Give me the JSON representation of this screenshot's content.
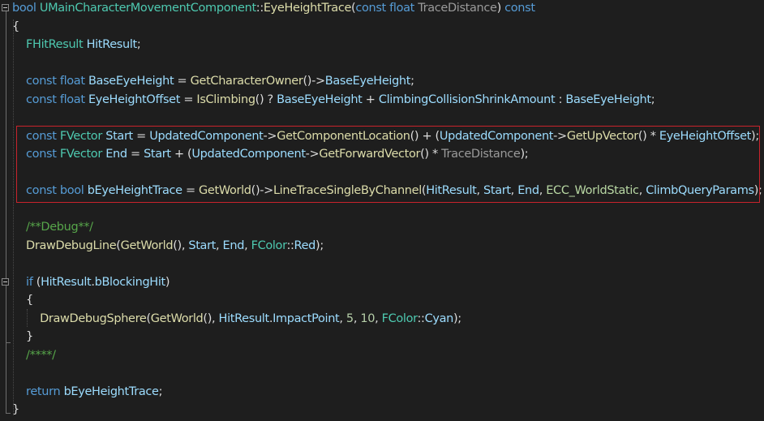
{
  "editor": {
    "language": "C++",
    "colors": {
      "background": "#1e1e1e",
      "keyword": "#569cd6",
      "type": "#4ec9b0",
      "function": "#dcdcaa",
      "variable": "#9cdcfe",
      "parameter": "#9a9a9a",
      "number": "#b5cea8",
      "comment": "#57a64a",
      "enum": "#b8d7a3",
      "text": "#dcdcdc",
      "highlight_border": "#c8232c"
    },
    "lines": [
      {
        "tokens": [
          {
            "c": "kw",
            "t": "bool"
          },
          {
            "c": "pl",
            "t": " "
          },
          {
            "c": "type",
            "t": "UMainCharacterMovementComponent"
          },
          {
            "c": "pl",
            "t": "::"
          },
          {
            "c": "fn",
            "t": "EyeHeightTrace"
          },
          {
            "c": "pl",
            "t": "("
          },
          {
            "c": "kw",
            "t": "const"
          },
          {
            "c": "pl",
            "t": " "
          },
          {
            "c": "kw",
            "t": "float"
          },
          {
            "c": "pl",
            "t": " "
          },
          {
            "c": "param",
            "t": "TraceDistance"
          },
          {
            "c": "pl",
            "t": ") "
          },
          {
            "c": "kw",
            "t": "const"
          }
        ]
      },
      {
        "tokens": [
          {
            "c": "pl",
            "t": "{"
          }
        ]
      },
      {
        "tokens": [
          {
            "c": "pl",
            "t": "    "
          },
          {
            "c": "type",
            "t": "FHitResult"
          },
          {
            "c": "pl",
            "t": " "
          },
          {
            "c": "var",
            "t": "HitResult"
          },
          {
            "c": "pl",
            "t": ";"
          }
        ]
      },
      {
        "tokens": []
      },
      {
        "tokens": [
          {
            "c": "pl",
            "t": "    "
          },
          {
            "c": "kw",
            "t": "const"
          },
          {
            "c": "pl",
            "t": " "
          },
          {
            "c": "kw",
            "t": "float"
          },
          {
            "c": "pl",
            "t": " "
          },
          {
            "c": "var",
            "t": "BaseEyeHeight"
          },
          {
            "c": "pl",
            "t": " = "
          },
          {
            "c": "fn",
            "t": "GetCharacterOwner"
          },
          {
            "c": "pl",
            "t": "()->"
          },
          {
            "c": "var",
            "t": "BaseEyeHeight"
          },
          {
            "c": "pl",
            "t": ";"
          }
        ]
      },
      {
        "tokens": [
          {
            "c": "pl",
            "t": "    "
          },
          {
            "c": "kw",
            "t": "const"
          },
          {
            "c": "pl",
            "t": " "
          },
          {
            "c": "kw",
            "t": "float"
          },
          {
            "c": "pl",
            "t": " "
          },
          {
            "c": "var",
            "t": "EyeHeightOffset"
          },
          {
            "c": "pl",
            "t": " = "
          },
          {
            "c": "fn",
            "t": "IsClimbing"
          },
          {
            "c": "pl",
            "t": "() ? "
          },
          {
            "c": "var",
            "t": "BaseEyeHeight"
          },
          {
            "c": "pl",
            "t": " + "
          },
          {
            "c": "var",
            "t": "ClimbingCollisionShrinkAmount"
          },
          {
            "c": "pl",
            "t": " : "
          },
          {
            "c": "var",
            "t": "BaseEyeHeight"
          },
          {
            "c": "pl",
            "t": ";"
          }
        ]
      },
      {
        "tokens": []
      },
      {
        "tokens": [
          {
            "c": "pl",
            "t": "    "
          },
          {
            "c": "kw",
            "t": "const"
          },
          {
            "c": "pl",
            "t": " "
          },
          {
            "c": "type",
            "t": "FVector"
          },
          {
            "c": "pl",
            "t": " "
          },
          {
            "c": "var",
            "t": "Start"
          },
          {
            "c": "pl",
            "t": " = "
          },
          {
            "c": "var",
            "t": "UpdatedComponent"
          },
          {
            "c": "pl",
            "t": "->"
          },
          {
            "c": "fn",
            "t": "GetComponentLocation"
          },
          {
            "c": "pl",
            "t": "() + ("
          },
          {
            "c": "var",
            "t": "UpdatedComponent"
          },
          {
            "c": "pl",
            "t": "->"
          },
          {
            "c": "fn",
            "t": "GetUpVector"
          },
          {
            "c": "pl",
            "t": "() * "
          },
          {
            "c": "var",
            "t": "EyeHeightOffset"
          },
          {
            "c": "pl",
            "t": ");"
          }
        ]
      },
      {
        "tokens": [
          {
            "c": "pl",
            "t": "    "
          },
          {
            "c": "kw",
            "t": "const"
          },
          {
            "c": "pl",
            "t": " "
          },
          {
            "c": "type",
            "t": "FVector"
          },
          {
            "c": "pl",
            "t": " "
          },
          {
            "c": "var",
            "t": "End"
          },
          {
            "c": "pl",
            "t": " = "
          },
          {
            "c": "var",
            "t": "Start"
          },
          {
            "c": "pl",
            "t": " + ("
          },
          {
            "c": "var",
            "t": "UpdatedComponent"
          },
          {
            "c": "pl",
            "t": "->"
          },
          {
            "c": "fn",
            "t": "GetForwardVector"
          },
          {
            "c": "pl",
            "t": "() * "
          },
          {
            "c": "param",
            "t": "TraceDistance"
          },
          {
            "c": "pl",
            "t": ");"
          }
        ]
      },
      {
        "tokens": []
      },
      {
        "tokens": [
          {
            "c": "pl",
            "t": "    "
          },
          {
            "c": "kw",
            "t": "const"
          },
          {
            "c": "pl",
            "t": " "
          },
          {
            "c": "kw",
            "t": "bool"
          },
          {
            "c": "pl",
            "t": " "
          },
          {
            "c": "var",
            "t": "bEyeHeightTrace"
          },
          {
            "c": "pl",
            "t": " = "
          },
          {
            "c": "fn",
            "t": "GetWorld"
          },
          {
            "c": "pl",
            "t": "()->"
          },
          {
            "c": "fn",
            "t": "LineTraceSingleByChannel"
          },
          {
            "c": "pl",
            "t": "("
          },
          {
            "c": "var",
            "t": "HitResult"
          },
          {
            "c": "pl",
            "t": ", "
          },
          {
            "c": "var",
            "t": "Start"
          },
          {
            "c": "pl",
            "t": ", "
          },
          {
            "c": "var",
            "t": "End"
          },
          {
            "c": "pl",
            "t": ", "
          },
          {
            "c": "enm",
            "t": "ECC_WorldStatic"
          },
          {
            "c": "pl",
            "t": ", "
          },
          {
            "c": "var",
            "t": "ClimbQueryParams"
          },
          {
            "c": "pl",
            "t": ");"
          }
        ]
      },
      {
        "tokens": []
      },
      {
        "tokens": [
          {
            "c": "pl",
            "t": "    "
          },
          {
            "c": "cmt",
            "t": "/**Debug**/"
          }
        ]
      },
      {
        "tokens": [
          {
            "c": "pl",
            "t": "    "
          },
          {
            "c": "fn",
            "t": "DrawDebugLine"
          },
          {
            "c": "pl",
            "t": "("
          },
          {
            "c": "fn",
            "t": "GetWorld"
          },
          {
            "c": "pl",
            "t": "(), "
          },
          {
            "c": "var",
            "t": "Start"
          },
          {
            "c": "pl",
            "t": ", "
          },
          {
            "c": "var",
            "t": "End"
          },
          {
            "c": "pl",
            "t": ", "
          },
          {
            "c": "type",
            "t": "FColor"
          },
          {
            "c": "pl",
            "t": "::"
          },
          {
            "c": "var",
            "t": "Red"
          },
          {
            "c": "pl",
            "t": ");"
          }
        ]
      },
      {
        "tokens": []
      },
      {
        "tokens": [
          {
            "c": "pl",
            "t": "    "
          },
          {
            "c": "kw",
            "t": "if"
          },
          {
            "c": "pl",
            "t": " ("
          },
          {
            "c": "var",
            "t": "HitResult"
          },
          {
            "c": "pl",
            "t": "."
          },
          {
            "c": "var",
            "t": "bBlockingHit"
          },
          {
            "c": "pl",
            "t": ")"
          }
        ]
      },
      {
        "tokens": [
          {
            "c": "pl",
            "t": "    {"
          }
        ]
      },
      {
        "tokens": [
          {
            "c": "pl",
            "t": "        "
          },
          {
            "c": "fn",
            "t": "DrawDebugSphere"
          },
          {
            "c": "pl",
            "t": "("
          },
          {
            "c": "fn",
            "t": "GetWorld"
          },
          {
            "c": "pl",
            "t": "(), "
          },
          {
            "c": "var",
            "t": "HitResult"
          },
          {
            "c": "pl",
            "t": "."
          },
          {
            "c": "var",
            "t": "ImpactPoint"
          },
          {
            "c": "pl",
            "t": ", "
          },
          {
            "c": "num",
            "t": "5"
          },
          {
            "c": "pl",
            "t": ", "
          },
          {
            "c": "num",
            "t": "10"
          },
          {
            "c": "pl",
            "t": ", "
          },
          {
            "c": "type",
            "t": "FColor"
          },
          {
            "c": "pl",
            "t": "::"
          },
          {
            "c": "var",
            "t": "Cyan"
          },
          {
            "c": "pl",
            "t": ");"
          }
        ]
      },
      {
        "tokens": [
          {
            "c": "pl",
            "t": "    }"
          }
        ]
      },
      {
        "tokens": [
          {
            "c": "pl",
            "t": "    "
          },
          {
            "c": "cmt",
            "t": "/****/"
          }
        ]
      },
      {
        "tokens": []
      },
      {
        "tokens": [
          {
            "c": "pl",
            "t": "    "
          },
          {
            "c": "kw",
            "t": "return"
          },
          {
            "c": "pl",
            "t": " "
          },
          {
            "c": "var",
            "t": "bEyeHeightTrace"
          },
          {
            "c": "pl",
            "t": ";"
          }
        ]
      },
      {
        "tokens": [
          {
            "c": "pl",
            "t": "}"
          }
        ]
      }
    ]
  }
}
